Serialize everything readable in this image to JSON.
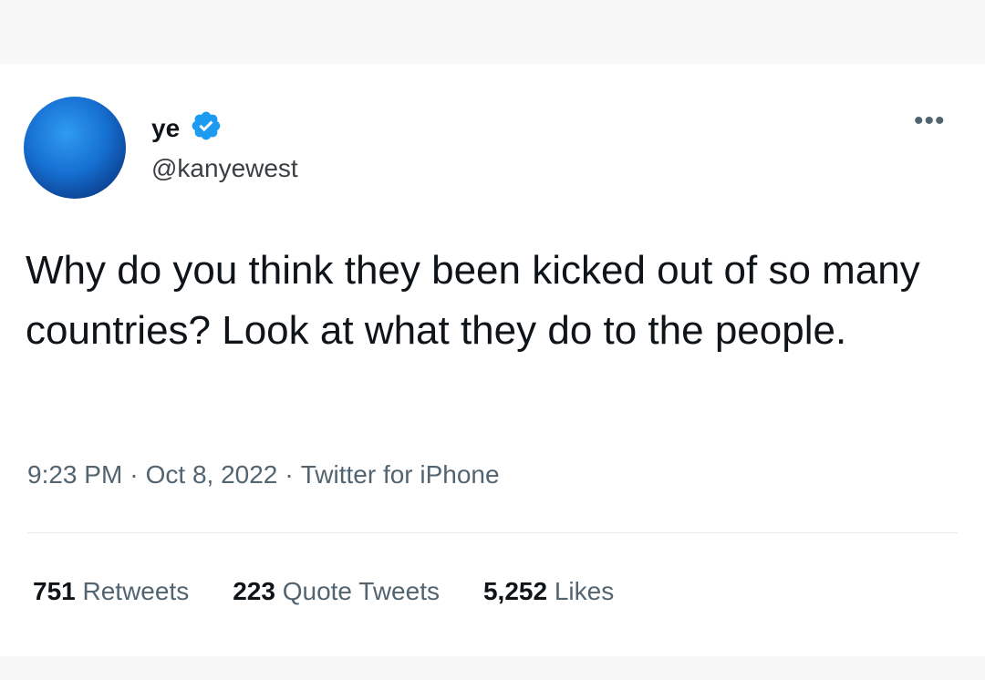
{
  "tweet": {
    "display_name": "ye",
    "handle": "@kanyewest",
    "verified_icon": "verified-badge-icon",
    "more_label": "•••",
    "text": "Why do you think they been kicked out of so many countries? Look at what they do to the people.",
    "time": "9:23 PM",
    "date": "Oct 8, 2022",
    "source": "Twitter for iPhone",
    "separator": "·",
    "stats": {
      "retweets_count": "751",
      "retweets_label": "Retweets",
      "quotes_count": "223",
      "quotes_label": "Quote Tweets",
      "likes_count": "5,252",
      "likes_label": "Likes"
    }
  },
  "colors": {
    "verified_blue": "#1d9bf0",
    "text": "#0f1419",
    "secondary": "#536471"
  }
}
